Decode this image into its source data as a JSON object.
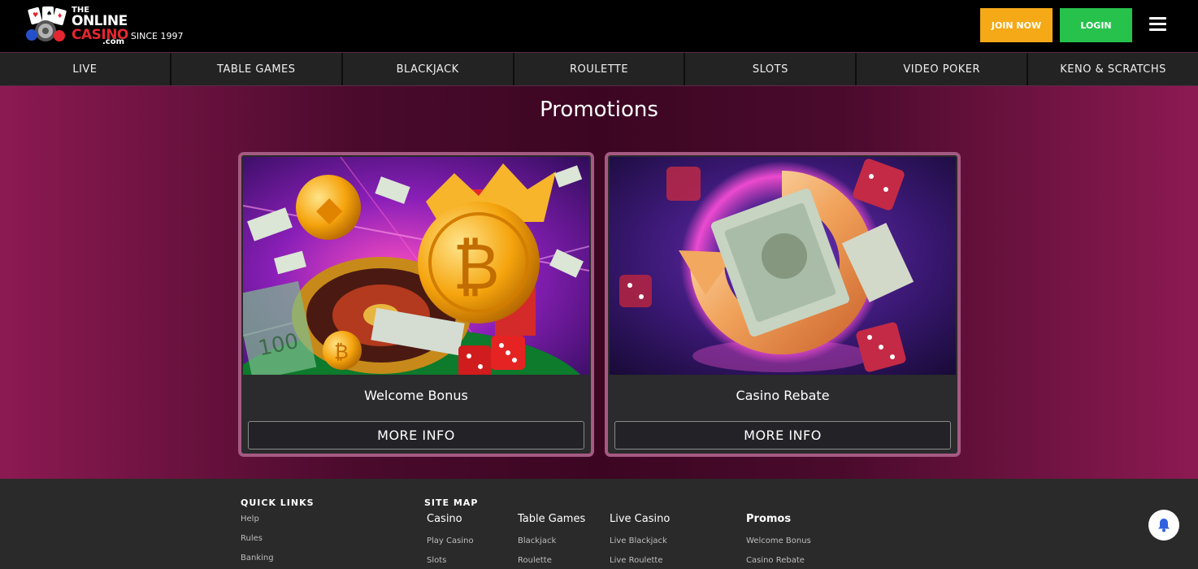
{
  "header": {
    "logo": {
      "the": "THE",
      "online": "ONLINE",
      "casino": "CASINO",
      "since": "SINCE 1997",
      "com": ".com"
    },
    "join_label": "JOIN NOW",
    "login_label": "LOGIN"
  },
  "nav": {
    "items": [
      {
        "label": "LIVE"
      },
      {
        "label": "TABLE GAMES"
      },
      {
        "label": "BLACKJACK"
      },
      {
        "label": "ROULETTE"
      },
      {
        "label": "SLOTS"
      },
      {
        "label": "VIDEO POKER"
      },
      {
        "label": "KENO & SCRATCHS"
      }
    ]
  },
  "main": {
    "title": "Promotions",
    "cards": [
      {
        "title": "Welcome Bonus",
        "button": "MORE INFO",
        "image_icon": "crypto-coins-roulette-image"
      },
      {
        "title": "Casino Rebate",
        "button": "MORE INFO",
        "image_icon": "cash-rebate-arrow-image"
      }
    ]
  },
  "footer": {
    "quick_links": {
      "heading": "QUICK LINKS",
      "items": [
        "Help",
        "Rules",
        "Banking"
      ]
    },
    "site_map": {
      "heading": "SITE MAP",
      "columns": [
        {
          "title": "Casino",
          "items": [
            "Play Casino",
            "Slots"
          ]
        },
        {
          "title": "Table Games",
          "items": [
            "Blackjack",
            "Roulette"
          ]
        },
        {
          "title": "Live Casino",
          "items": [
            "Live Blackjack",
            "Live Roulette"
          ]
        },
        {
          "title": "Promos",
          "items": [
            "Welcome Bonus",
            "Casino Rebate"
          ]
        }
      ]
    }
  },
  "colors": {
    "join": "#f5a917",
    "login": "#27c24c",
    "brand_red": "#e4262f",
    "card_border": "#a55a83",
    "chat": "#28b44a"
  },
  "icons": {
    "menu": "hamburger-menu-icon",
    "chat": "chat-bubble-icon",
    "notifications": "bell-icon"
  }
}
